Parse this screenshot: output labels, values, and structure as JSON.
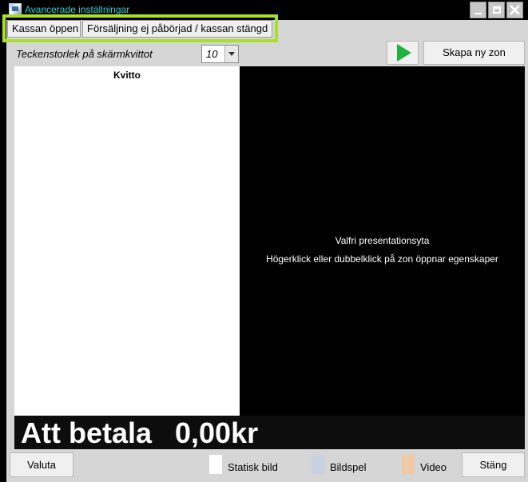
{
  "window": {
    "title": "Avancerade inställningar",
    "icons": {
      "app": "app-window-icon",
      "minimize": "minimize-icon",
      "maximize": "maximize-icon",
      "close": "close-icon"
    }
  },
  "tabs": [
    {
      "label": "Kassan öppen"
    },
    {
      "label": "Försäljning ej påbörjad / kassan stängd"
    }
  ],
  "toolbar": {
    "font_size_label": "Teckenstorlek på skärmkvittot",
    "font_size_value": "10",
    "create_zone_label": "Skapa ny zon",
    "play_icon": "play-icon",
    "dropdown_icon": "chevron-down-icon"
  },
  "receipt": {
    "title": "Kvitto"
  },
  "presentation": {
    "line1": "Valfri presentationsyta",
    "line2": "Högerklick eller dubbelklick på zon öppnar egenskaper"
  },
  "pay": {
    "label": "Att betala",
    "amount": "0,00kr"
  },
  "bottom": {
    "currency_label": "Valuta",
    "legend": [
      {
        "label": "Statisk bild",
        "color": "#ffffff"
      },
      {
        "label": "Bildspel",
        "color": "#c8d2de"
      },
      {
        "label": "Video",
        "color": "#f0c9a6"
      }
    ],
    "close_label": "Stäng"
  },
  "colors": {
    "tab_highlight": "#a8e02a",
    "title_text": "#2fd1d1",
    "play_green": "#1fb33d"
  }
}
